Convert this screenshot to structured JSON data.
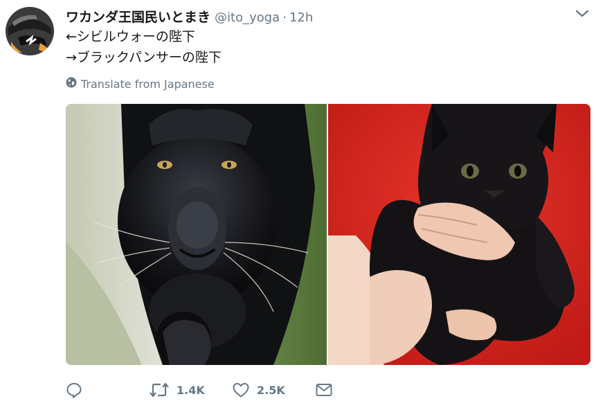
{
  "tweet": {
    "display_name": "ワカンダ王国民いとまき",
    "handle": "@ito_yoga",
    "separator": "·",
    "time": "12h",
    "lines": [
      "←シビルウォーの陛下",
      "→ブラックパンサーの陛下"
    ],
    "translate_label": "Translate from Japanese"
  },
  "actions": {
    "reply_count": "",
    "retweet_count": "1.4K",
    "like_count": "2.5K"
  },
  "media": {
    "photos": [
      {
        "subject": "black panther"
      },
      {
        "subject": "black kitten"
      }
    ]
  },
  "colors": {
    "text": "#14171a",
    "secondary": "#657786",
    "kitten_background": "#d9261f"
  },
  "icons": [
    "caret-down-icon",
    "globe-icon",
    "reply-icon",
    "retweet-icon",
    "heart-icon",
    "direct-message-icon"
  ]
}
